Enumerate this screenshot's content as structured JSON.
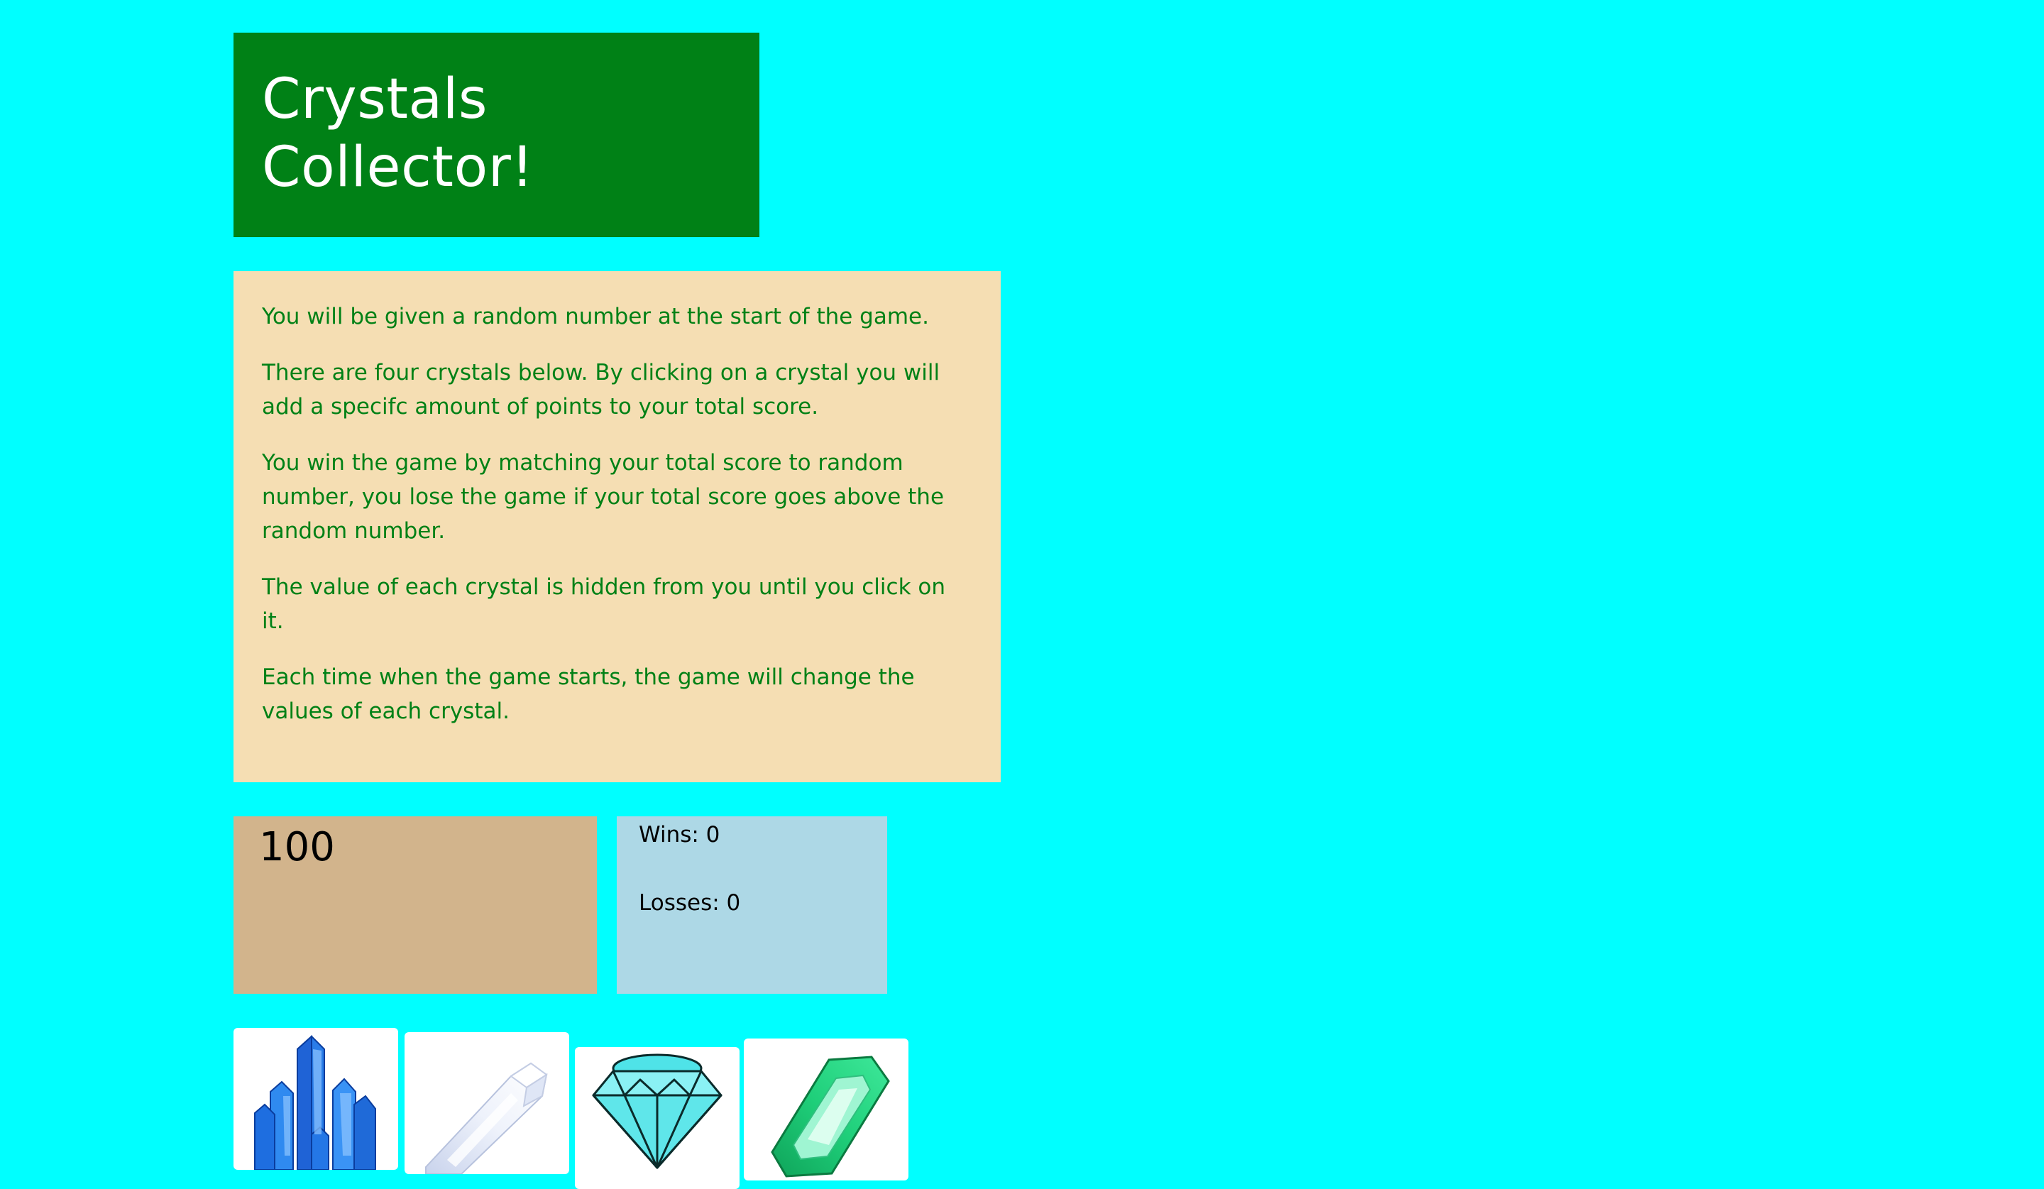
{
  "title": "Crystals Collector!",
  "instructions": [
    "You will be given a random number at the start of the game.",
    "There are four crystals below. By clicking on a crystal you will add a specifc amount of points to your total score.",
    "You win the game by matching your total score to random number, you lose the game if your total score goes above the random number.",
    "The value of each crystal is hidden from you until you click on it.",
    "Each time when the game starts, the game will change the values of each crystal."
  ],
  "target_number": "100",
  "scoreboard": {
    "wins": "Wins: 0",
    "losses": "Losses: 0"
  },
  "crystals": [
    {
      "icon": "blue-crystal-cluster-icon"
    },
    {
      "icon": "white-quartz-crystal-icon"
    },
    {
      "icon": "cyan-diamond-icon"
    },
    {
      "icon": "green-emerald-icon"
    }
  ],
  "colors": {
    "page_background": "#00ffff",
    "title_background": "#008116",
    "instructions_background": "#f5deb3",
    "instructions_text": "#008116",
    "target_background": "#d2b48c",
    "score_background": "#add8e6"
  }
}
